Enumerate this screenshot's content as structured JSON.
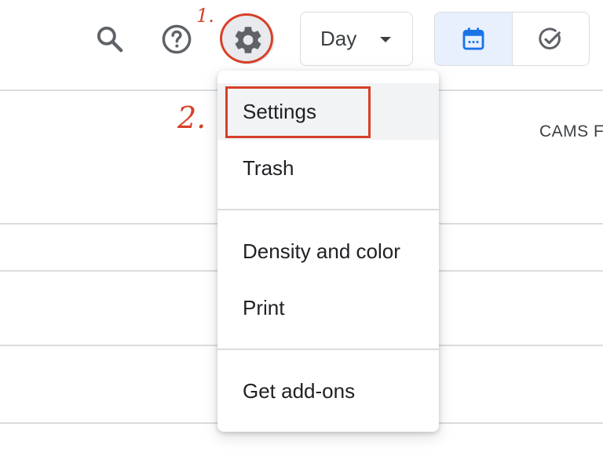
{
  "header": {
    "view_select": {
      "label": "Day"
    },
    "toggle": {
      "items": [
        "calendar-icon",
        "task-check-icon"
      ],
      "active": 0,
      "accent": "#1a73e8"
    }
  },
  "icons": {
    "search": "search-icon",
    "help": "help-icon",
    "settings": "gear-icon"
  },
  "grid": {
    "column_label": "CAMS F"
  },
  "settings_menu": {
    "items": [
      {
        "label": "Settings"
      },
      {
        "label": "Trash"
      },
      {
        "label": "Density and color"
      },
      {
        "label": "Print"
      },
      {
        "label": "Get add-ons"
      }
    ]
  },
  "annotations": {
    "step1": "1.",
    "step2": "2.",
    "color": "#d64027"
  }
}
